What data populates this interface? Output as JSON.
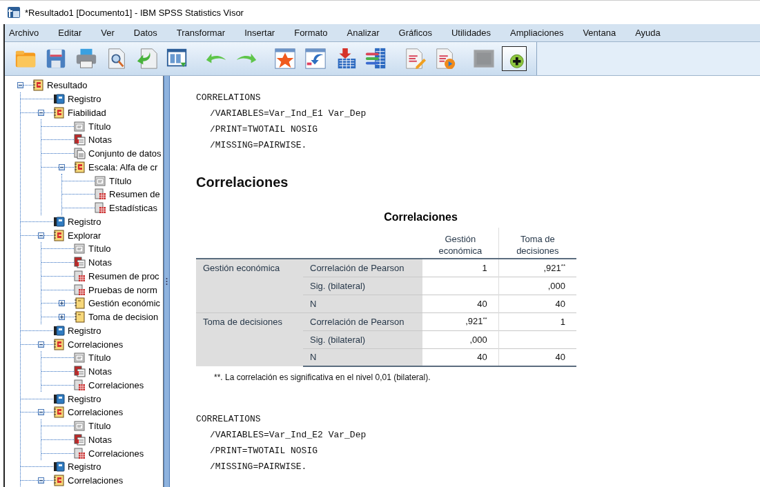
{
  "window": {
    "title": "*Resultado1 [Documento1] - IBM SPSS Statistics Visor"
  },
  "menu": [
    "Archivo",
    "Editar",
    "Ver",
    "Datos",
    "Transformar",
    "Insertar",
    "Formato",
    "Analizar",
    "Gráficos",
    "Utilidades",
    "Ampliaciones",
    "Ventana",
    "Ayuda"
  ],
  "toolbar": [
    {
      "disabled": false,
      "pressed": false
    },
    {
      "disabled": false,
      "pressed": false
    },
    {
      "disabled": false,
      "pressed": false
    },
    {
      "disabled": false,
      "pressed": false
    },
    {
      "disabled": false,
      "pressed": false
    },
    {
      "disabled": false,
      "pressed": false
    },
    {
      "disabled": false,
      "pressed": false
    },
    {
      "disabled": false,
      "pressed": false
    },
    {
      "disabled": false,
      "pressed": false
    },
    {
      "disabled": false,
      "pressed": false
    },
    {
      "disabled": false,
      "pressed": false
    },
    {
      "disabled": false,
      "pressed": false
    },
    {
      "disabled": false,
      "pressed": false
    },
    {
      "disabled": false,
      "pressed": false
    },
    {
      "disabled": true,
      "pressed": false
    },
    {
      "disabled": false,
      "pressed": true
    }
  ],
  "outline": [
    {
      "kind": "folder",
      "label": "Resultado",
      "expanded": true,
      "children": [
        {
          "kind": "log",
          "label": "Registro"
        },
        {
          "kind": "folder",
          "label": "Fiabilidad",
          "expanded": true,
          "children": [
            {
              "kind": "title",
              "label": "Título"
            },
            {
              "kind": "notes",
              "label": "Notas"
            },
            {
              "kind": "dataset",
              "label": "Conjunto de datos"
            },
            {
              "kind": "folder",
              "label": "Escala: Alfa de cr",
              "expanded": true,
              "children": [
                {
                  "kind": "title",
                  "label": "Título"
                },
                {
                  "kind": "table",
                  "label": "Resumen de"
                },
                {
                  "kind": "table",
                  "label": "Estadísticas"
                }
              ]
            }
          ]
        },
        {
          "kind": "log",
          "label": "Registro"
        },
        {
          "kind": "folder",
          "label": "Explorar",
          "expanded": true,
          "children": [
            {
              "kind": "title",
              "label": "Título"
            },
            {
              "kind": "notes",
              "label": "Notas"
            },
            {
              "kind": "table",
              "label": "Resumen de proc"
            },
            {
              "kind": "table",
              "label": "Pruebas de norm"
            },
            {
              "kind": "page",
              "label": "Gestión económic",
              "expanded": false
            },
            {
              "kind": "page",
              "label": "Toma de decision",
              "expanded": false
            }
          ]
        },
        {
          "kind": "log",
          "label": "Registro"
        },
        {
          "kind": "folder",
          "label": "Correlaciones",
          "expanded": true,
          "children": [
            {
              "kind": "title",
              "label": "Título"
            },
            {
              "kind": "notes",
              "label": "Notas"
            },
            {
              "kind": "table",
              "label": "Correlaciones"
            }
          ]
        },
        {
          "kind": "log",
          "label": "Registro"
        },
        {
          "kind": "folder",
          "label": "Correlaciones",
          "expanded": true,
          "children": [
            {
              "kind": "title",
              "label": "Título"
            },
            {
              "kind": "notes",
              "label": "Notas"
            },
            {
              "kind": "table",
              "label": "Correlaciones"
            }
          ]
        },
        {
          "kind": "log",
          "label": "Registro"
        },
        {
          "kind": "folder",
          "label": "Correlaciones",
          "expanded": true
        }
      ]
    }
  ],
  "output": [
    {
      "kind": "syntax",
      "lines": [
        {
          "text": "CORRELATIONS",
          "indented": false
        },
        {
          "text": "/VARIABLES=Var_Ind_E1 Var_Dep",
          "indented": true
        },
        {
          "text": "/PRINT=TWOTAIL NOSIG",
          "indented": true
        },
        {
          "text": "/MISSING=PAIRWISE.",
          "indented": true
        }
      ]
    },
    {
      "kind": "heading",
      "text": "Correlaciones"
    },
    {
      "kind": "table",
      "title": "Correlaciones",
      "columns": [
        "Gestión económica",
        "Toma de decisiones"
      ],
      "groups": [
        {
          "label": "Gestión económica",
          "rows": [
            {
              "stat": "Correlación de Pearson",
              "column_1": "1",
              "column_2": ",921$^{**}$"
            },
            {
              "stat": "Sig. (bilateral)",
              "column_2": ",000"
            },
            {
              "stat": "N",
              "column_1": "40",
              "column_2": "40"
            }
          ]
        },
        {
          "label": "Toma de decisiones",
          "rows": [
            {
              "stat": "Correlación de Pearson",
              "column_1": ",921$^{**}$",
              "column_2": "1"
            },
            {
              "stat": "Sig. (bilateral)",
              "column_1": ",000"
            },
            {
              "stat": "N",
              "column_1": "40",
              "column_2": "40"
            }
          ]
        }
      ],
      "footnote": "**. La correlación es significativa en el nivel 0,01 (bilateral)."
    },
    {
      "kind": "syntax",
      "lines": [
        {
          "text": "CORRELATIONS",
          "indented": false
        },
        {
          "text": "/VARIABLES=Var_Ind_E2 Var_Dep",
          "indented": true
        },
        {
          "text": "/PRINT=TWOTAIL NOSIG",
          "indented": true
        },
        {
          "text": "/MISSING=PAIRWISE.",
          "indented": true
        }
      ]
    }
  ]
}
